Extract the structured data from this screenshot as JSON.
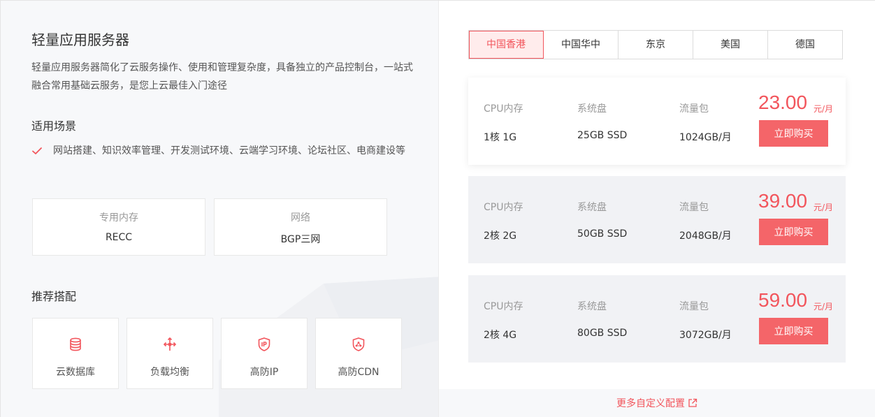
{
  "product": {
    "title": "轻量应用服务器",
    "description": "轻量应用服务器简化了云服务操作、使用和管理复杂度，具备独立的产品控制台，一站式融合常用基础云服务，是您上云最佳入门途径"
  },
  "scenarios": {
    "heading": "适用场景",
    "text": "网站搭建、知识效率管理、开发测试环境、云端学习环境、论坛社区、电商建设等"
  },
  "specs": [
    {
      "label": "专用内存",
      "value": "RECC"
    },
    {
      "label": "网络",
      "value": "BGP三网"
    }
  ],
  "recommend": {
    "heading": "推荐搭配",
    "items": [
      {
        "label": "云数据库",
        "icon": "database-icon"
      },
      {
        "label": "负载均衡",
        "icon": "load-balance-icon"
      },
      {
        "label": "高防IP",
        "icon": "ip-shield-icon"
      },
      {
        "label": "高防CDN",
        "icon": "cdn-shield-icon"
      }
    ]
  },
  "regions": {
    "tabs": [
      "中国香港",
      "中国华中",
      "东京",
      "美国",
      "德国"
    ],
    "active": "中国香港"
  },
  "plans": [
    {
      "cpu_mem_label": "CPU内存",
      "disk_label": "系统盘",
      "traffic_label": "流量包",
      "cpu_mem": "1核 1G",
      "disk": "25GB SSD",
      "traffic": "1024GB/月",
      "price": "23.00",
      "unit": "元/月",
      "buy": "立即购买"
    },
    {
      "cpu_mem_label": "CPU内存",
      "disk_label": "系统盘",
      "traffic_label": "流量包",
      "cpu_mem": "2核 2G",
      "disk": "50GB SSD",
      "traffic": "2048GB/月",
      "price": "39.00",
      "unit": "元/月",
      "buy": "立即购买"
    },
    {
      "cpu_mem_label": "CPU内存",
      "disk_label": "系统盘",
      "traffic_label": "流量包",
      "cpu_mem": "2核 4G",
      "disk": "80GB SSD",
      "traffic": "3072GB/月",
      "price": "59.00",
      "unit": "元/月",
      "buy": "立即购买"
    }
  ],
  "more_link": "更多自定义配置",
  "colors": {
    "accent": "#f2555c",
    "button": "#f46569",
    "panel": "#f7f8fa",
    "plan_bg": "#f1f2f5"
  }
}
